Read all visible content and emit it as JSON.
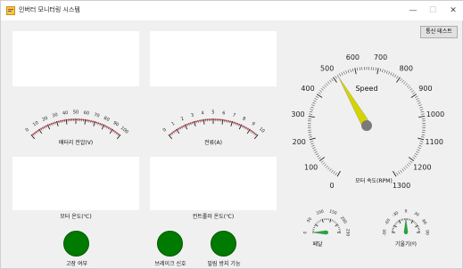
{
  "window": {
    "title": "인버터 모니터링 시스템",
    "min_glyph": "—",
    "max_glyph": "☐",
    "close_glyph": "✕",
    "app_icon": "form-icon"
  },
  "toolbar": {
    "comm_test_label": "통신 테스트"
  },
  "gauges": {
    "battery": {
      "label": "배터리 전압(V)",
      "ticks": [
        "0",
        "10",
        "20",
        "30",
        "40",
        "50",
        "60",
        "70",
        "80",
        "90",
        "100"
      ],
      "min": 0,
      "max": 100,
      "value": 0
    },
    "current": {
      "label": "전류(A)",
      "ticks": [
        "0",
        "1",
        "2",
        "3",
        "4",
        "5",
        "6",
        "7",
        "8",
        "9",
        "10"
      ],
      "min": 0,
      "max": 10,
      "value": 0
    },
    "speed": {
      "title": "Speed",
      "label": "모터 속도(RPM)",
      "ticks": [
        "0",
        "100",
        "200",
        "300",
        "400",
        "500",
        "600",
        "700",
        "800",
        "900",
        "1000",
        "1100",
        "1200",
        "1300"
      ],
      "min": 0,
      "max": 1300,
      "value": 520,
      "needle_color": "#d4d400"
    },
    "pedal": {
      "label": "페달",
      "ticks": [
        "0",
        "50",
        "100",
        "150",
        "200",
        "250"
      ],
      "min": 0,
      "max": 250,
      "value": 0,
      "needle_color": "#1faa3a"
    },
    "tilt": {
      "label": "기울기(º)",
      "ticks": [
        "-90",
        "-60",
        "-30",
        "0",
        "30",
        "60",
        "90"
      ],
      "min": -90,
      "max": 90,
      "value": 0,
      "needle_color": "#1faa3a"
    }
  },
  "panels": {
    "motor_temp_label": "모터 온도(℃)",
    "controller_temp_label": "컨트롤러 온도(℃)"
  },
  "indicators": {
    "fault_label": "고장 여부",
    "brake_label": "브레이크 신호",
    "rollback_label": "밀림 방지 기능",
    "on_color": "#007a00"
  }
}
